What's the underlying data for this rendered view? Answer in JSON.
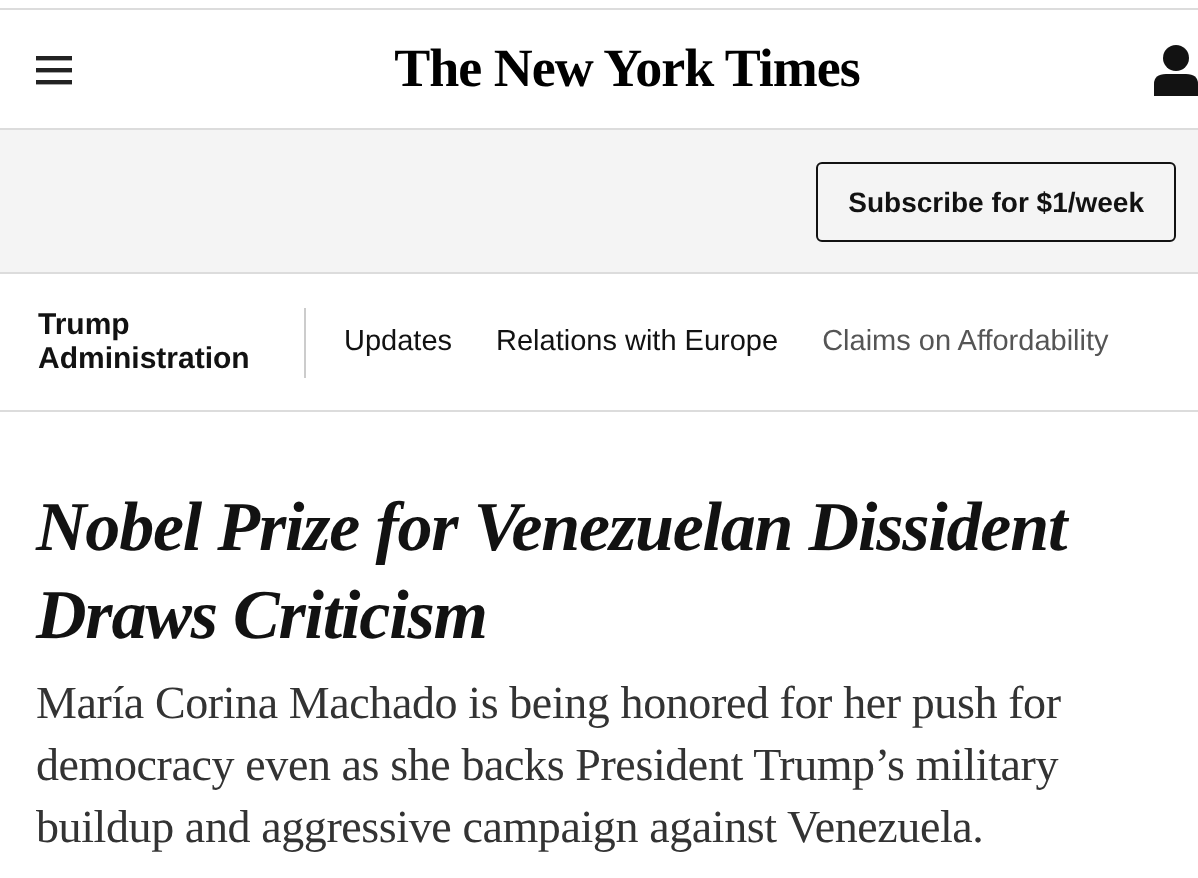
{
  "masthead": {
    "logo": "The New York Times"
  },
  "subscribe": {
    "label": "Subscribe for $1/week"
  },
  "section_nav": {
    "title": "Trump Administration",
    "items": [
      {
        "label": "Updates"
      },
      {
        "label": "Relations with Europe"
      },
      {
        "label": "Claims on Affordability"
      }
    ]
  },
  "article": {
    "headline": "Nobel Prize for Venezuelan Dissident Draws Criticism",
    "summary": "María Corina Machado is being honored for her push for democracy even as she backs President Trump’s military buildup and aggressive campaign against Venezuela."
  }
}
